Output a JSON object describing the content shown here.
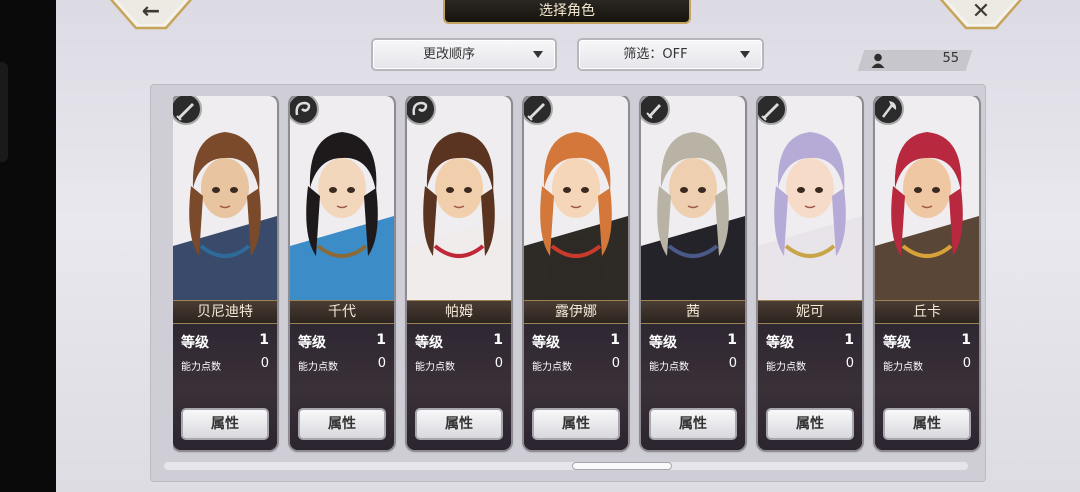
{
  "header": {
    "title": "选择角色",
    "back_glyph": "←",
    "close_glyph": "✕"
  },
  "controls": {
    "sort_label": "更改顺序",
    "filter_label": "筛选：OFF",
    "count": "55"
  },
  "stat_labels": {
    "level": "等级",
    "points": "能力点数",
    "attr_button": "属性"
  },
  "characters": [
    {
      "name": "贝尼迪特",
      "level": "1",
      "points": "0",
      "weapon": "sword-icon",
      "hair": "#7a4a2a",
      "skin": "#e8c4a0",
      "cloth": "#3a4a6a",
      "accent": "#2e6a9a"
    },
    {
      "name": "千代",
      "level": "1",
      "points": "0",
      "weapon": "whip-icon",
      "hair": "#1e1a1c",
      "skin": "#f3d7bd",
      "cloth": "#3c8cc8",
      "accent": "#8b6a3a"
    },
    {
      "name": "帕姆",
      "level": "1",
      "points": "0",
      "weapon": "whip-icon",
      "hair": "#5a3420",
      "skin": "#f1cfac",
      "cloth": "#f0ecec",
      "accent": "#c0283a"
    },
    {
      "name": "露伊娜",
      "level": "1",
      "points": "0",
      "weapon": "sword-icon",
      "hair": "#d3783a",
      "skin": "#f5d6b8",
      "cloth": "#2e2a26",
      "accent": "#c83a2c"
    },
    {
      "name": "茜",
      "level": "1",
      "points": "0",
      "weapon": "dagger-icon",
      "hair": "#b9b3a6",
      "skin": "#eecfb0",
      "cloth": "#25232a",
      "accent": "#4a5a88"
    },
    {
      "name": "妮可",
      "level": "1",
      "points": "0",
      "weapon": "sword-icon",
      "hair": "#b6aad6",
      "skin": "#f6dcc8",
      "cloth": "#e8e4ea",
      "accent": "#c9a54a"
    },
    {
      "name": "丘卡",
      "level": "1",
      "points": "0",
      "weapon": "axe-icon",
      "hair": "#b8283e",
      "skin": "#efc7a2",
      "cloth": "#5a4636",
      "accent": "#d8a23a"
    }
  ]
}
